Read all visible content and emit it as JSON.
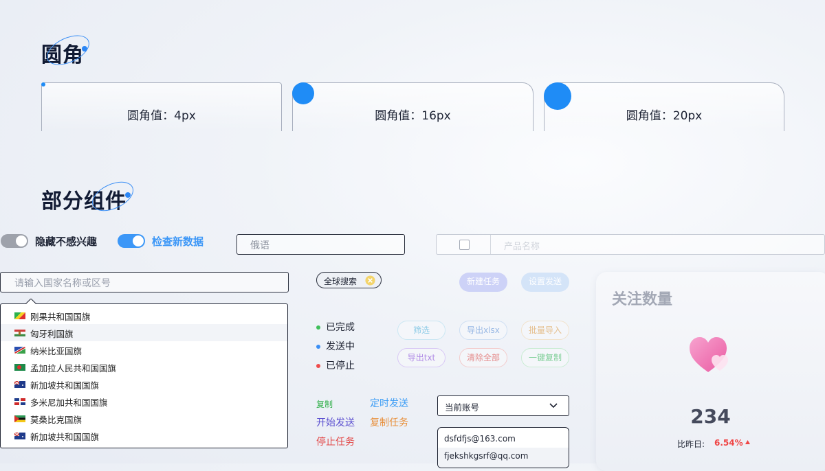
{
  "section_radius": {
    "title": "圆角"
  },
  "radius_cards": [
    {
      "label": "圆角值：4px"
    },
    {
      "label": "圆角值：16px"
    },
    {
      "label": "圆角值：20px"
    }
  ],
  "section_components": {
    "title": "部分组件"
  },
  "toggles": [
    {
      "label": "隐藏不感兴趣",
      "on": false
    },
    {
      "label": "检查新数据",
      "on": true
    }
  ],
  "language_input": {
    "value": "俄语"
  },
  "product_input": {
    "placeholder": "产品名称"
  },
  "country_search": {
    "placeholder": "请输入国家名称或区号"
  },
  "country_list": [
    {
      "name": "刚果共和国国旗",
      "flag": "congo"
    },
    {
      "name": "匈牙利国旗",
      "flag": "hungary"
    },
    {
      "name": "纳米比亚国旗",
      "flag": "namibia"
    },
    {
      "name": "孟加拉人民共和国国旗",
      "flag": "bangladesh"
    },
    {
      "name": "新加坡共和国国旗",
      "flag": "australia-like"
    },
    {
      "name": "多米尼加共和国国旗",
      "flag": "dominican"
    },
    {
      "name": "莫桑比克国旗",
      "flag": "mozambique"
    },
    {
      "name": "新加坡共和国国旗",
      "flag": "australia-like"
    }
  ],
  "search_chip": {
    "label": "全球搜索",
    "icon": "close-circle-icon"
  },
  "statuses": [
    {
      "label": "已完成",
      "color": "#3fbf5a"
    },
    {
      "label": "发送中",
      "color": "#3a8ef5"
    },
    {
      "label": "已停止",
      "color": "#ef4b4b"
    }
  ],
  "pill_buttons": {
    "new_task": "新建任务",
    "set_send": "设置发送",
    "filter": "筛选",
    "export_xlsx": "导出xlsx",
    "batch_import": "批量导入",
    "export_txt": "导出txt",
    "clear_all": "清除全部",
    "copy_all": "一键复制"
  },
  "text_links": {
    "copy": "复制",
    "start_send": "开始发送",
    "stop_task": "停止任务",
    "timed_send": "定时发送",
    "copy_task": "复制任务"
  },
  "account_select": {
    "label": "当前账号",
    "icon": "chevron-down-icon"
  },
  "account_options": [
    "dsfdfjs@163.com",
    "fjekshkgsrf@qq.com"
  ],
  "follow_card": {
    "title": "关注数量",
    "count": "234",
    "compare_label": "比昨日:",
    "change": "6.54%",
    "trend_icon": "up-triangle-icon",
    "icon": "heart-icon"
  }
}
